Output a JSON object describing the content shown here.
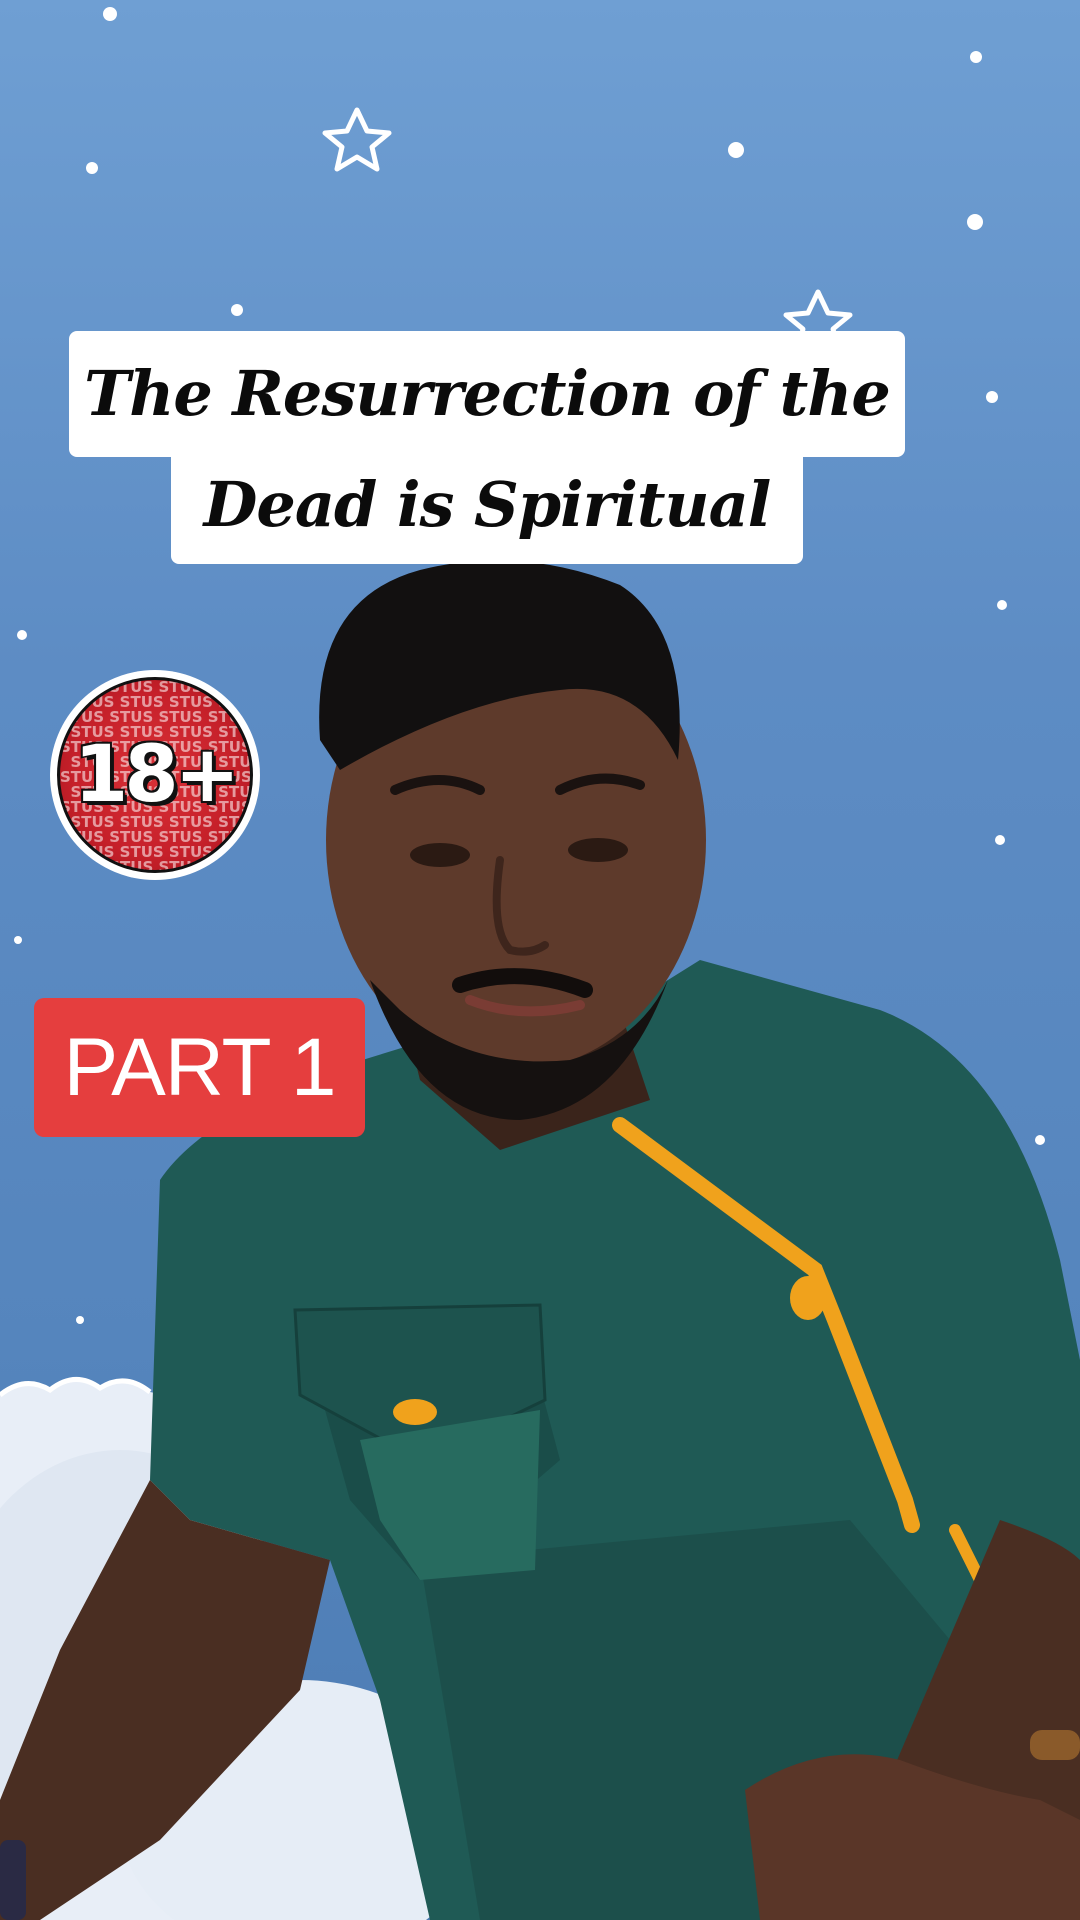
{
  "caption": {
    "line1": "The Resurrection of the",
    "line2": "Dead is Spiritual"
  },
  "badge": {
    "text": "18+",
    "pattern_word": "STUS",
    "colors": {
      "fill": "#c6202a",
      "ring": "#ffffff"
    }
  },
  "part_label": {
    "text": "PART 1",
    "color": "#e53e3e"
  },
  "scene": {
    "background_color": "#5d8cc4",
    "decorations": [
      "star-icon",
      "cloud-shape"
    ],
    "subject": "man-speaking",
    "shirt_color": "#1f5a55",
    "trim_color": "#f0a21c"
  }
}
